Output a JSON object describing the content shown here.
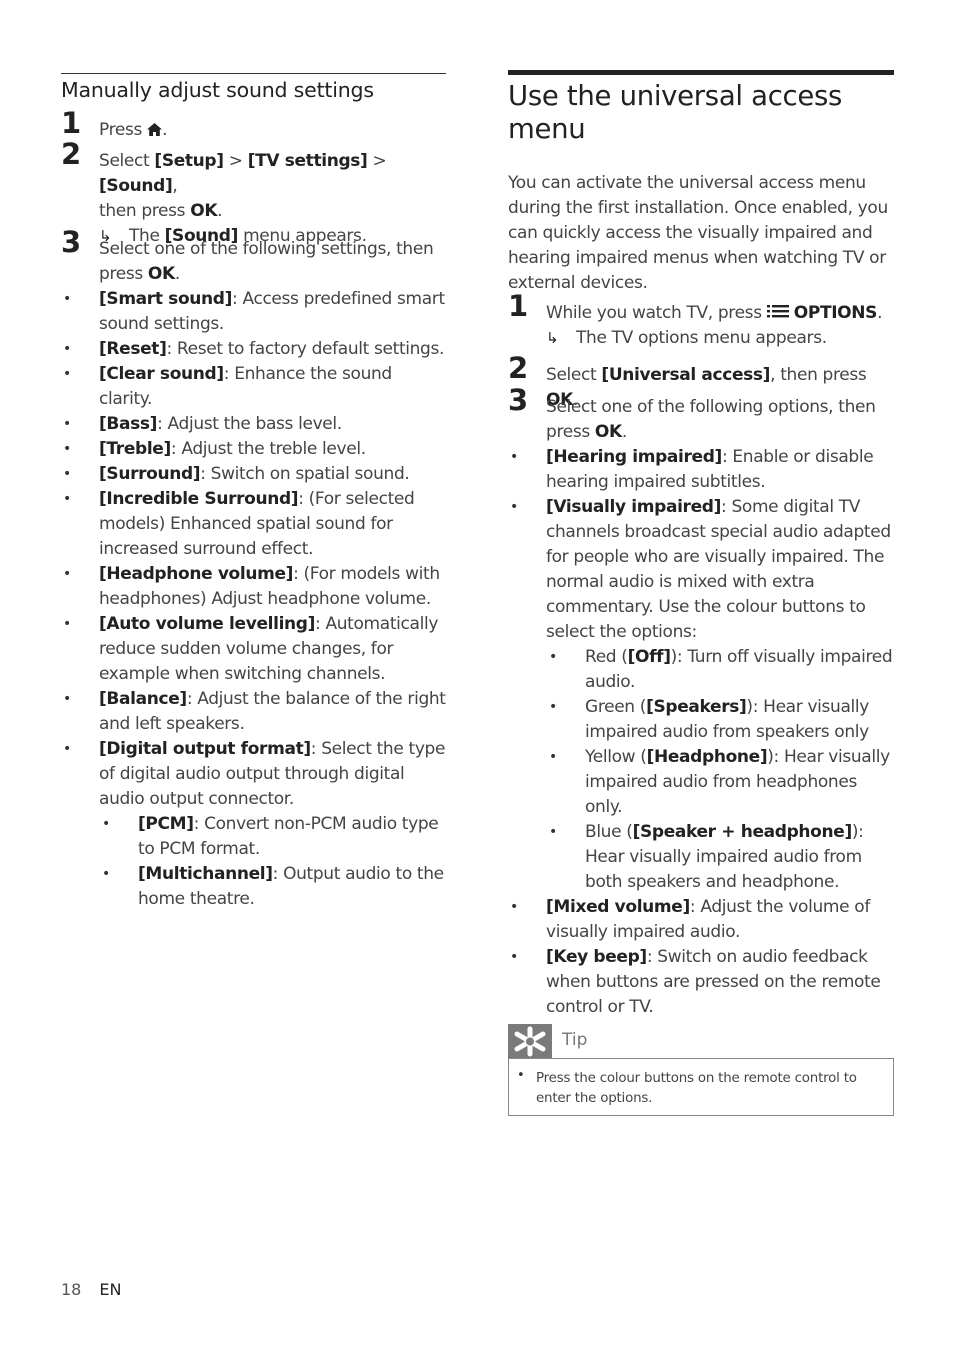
{
  "left": {
    "heading": "Manually adjust sound settings",
    "steps": [
      {
        "num": "1",
        "text": "Press",
        "icon": "home-icon",
        "after": "."
      },
      {
        "num": "2",
        "pre": "Select ",
        "b1": "[Setup]",
        "sep1": " > ",
        "b2": "[TV settings]",
        "sep2": " > ",
        "b3": "[Sound]",
        "post": ",",
        "line2_pre": "then press ",
        "line2_b": "OK",
        "line2_post": ".",
        "result_pre": "The ",
        "result_b": "[Sound]",
        "result_post": " menu appears."
      },
      {
        "num": "3",
        "line1": "Select one of the following settings, then",
        "line2_pre": "press ",
        "line2_b": "OK",
        "line2_post": "."
      }
    ],
    "bullets": [
      {
        "term": "[Smart sound]",
        "desc": ": Access predefined smart sound settings."
      },
      {
        "term": "[Reset]",
        "desc": ": Reset to factory default settings."
      },
      {
        "term": "[Clear sound]",
        "desc": ": Enhance the sound clarity."
      },
      {
        "term": "[Bass]",
        "desc": ": Adjust the bass level."
      },
      {
        "term": "[Treble]",
        "desc": ": Adjust the treble level."
      },
      {
        "term": "[Surround]",
        "desc": ": Switch on spatial sound."
      },
      {
        "term": "[Incredible Surround]",
        "desc": ": (For selected models) Enhanced spatial sound for increased surround effect."
      },
      {
        "term": "[Headphone volume]",
        "desc": ": (For models with headphones) Adjust headphone volume."
      },
      {
        "term": "[Auto volume levelling]",
        "desc": ": Automatically reduce sudden volume changes, for example when switching channels."
      },
      {
        "term": "[Balance]",
        "desc": ": Adjust the balance of the right and left speakers."
      },
      {
        "term": "[Digital output format]",
        "desc": ": Select the type of digital audio output through digital audio output connector."
      }
    ],
    "sub_bullets": [
      {
        "term": "[PCM]",
        "desc": ": Convert non-PCM audio type to PCM format."
      },
      {
        "term": "[Multichannel]",
        "desc": ": Output audio to the home theatre."
      }
    ]
  },
  "right": {
    "heading": "Use the universal access menu",
    "intro": "You can activate the universal access menu during the first installation. Once enabled, you can quickly access the visually impaired and hearing impaired menus when watching TV or external devices.",
    "steps": [
      {
        "num": "1",
        "pre": "While you watch TV, press ",
        "icon": "options-list-icon",
        "b": "OPTIONS",
        "post": ".",
        "result": "The TV options menu appears."
      },
      {
        "num": "2",
        "pre": "Select ",
        "b": "[Universal access]",
        "mid": ", then press ",
        "b2": "OK",
        "post": "."
      },
      {
        "num": "3",
        "line1": "Select one of the following options, then",
        "line2_pre": "press ",
        "line2_b": "OK",
        "line2_post": "."
      }
    ],
    "bullets": [
      {
        "term": "[Hearing impaired]",
        "desc": ": Enable or disable hearing impaired subtitles."
      },
      {
        "term": "[Visually impaired]",
        "desc": ": Some digital TV channels broadcast special audio adapted for people who are visually impaired. The normal audio is mixed with extra commentary. Use the colour buttons to select the options:"
      }
    ],
    "sub_bullets": [
      {
        "pre": "Red (",
        "term": "[Off]",
        "desc": "): Turn off visually impaired audio."
      },
      {
        "pre": "Green (",
        "term": "[Speakers]",
        "desc": "): Hear visually impaired audio from speakers only"
      },
      {
        "pre": "Yellow (",
        "term": "[Headphone]",
        "desc": "): Hear visually impaired audio from headphones only."
      },
      {
        "pre": "Blue (",
        "term": "[Speaker + headphone]",
        "desc": "): Hear visually impaired audio from both speakers and headphone."
      }
    ],
    "bullets2": [
      {
        "term": "[Mixed volume]",
        "desc": ": Adjust the volume of visually impaired audio."
      },
      {
        "term": "[Key beep]",
        "desc": ": Switch on audio feedback when buttons are pressed on the remote control or TV."
      }
    ],
    "tip": {
      "label": "Tip",
      "icon": "asterisk-tip-icon",
      "text": "Press the colour buttons on the remote control to enter the options."
    }
  },
  "footer": {
    "page": "18",
    "lang": "EN"
  }
}
